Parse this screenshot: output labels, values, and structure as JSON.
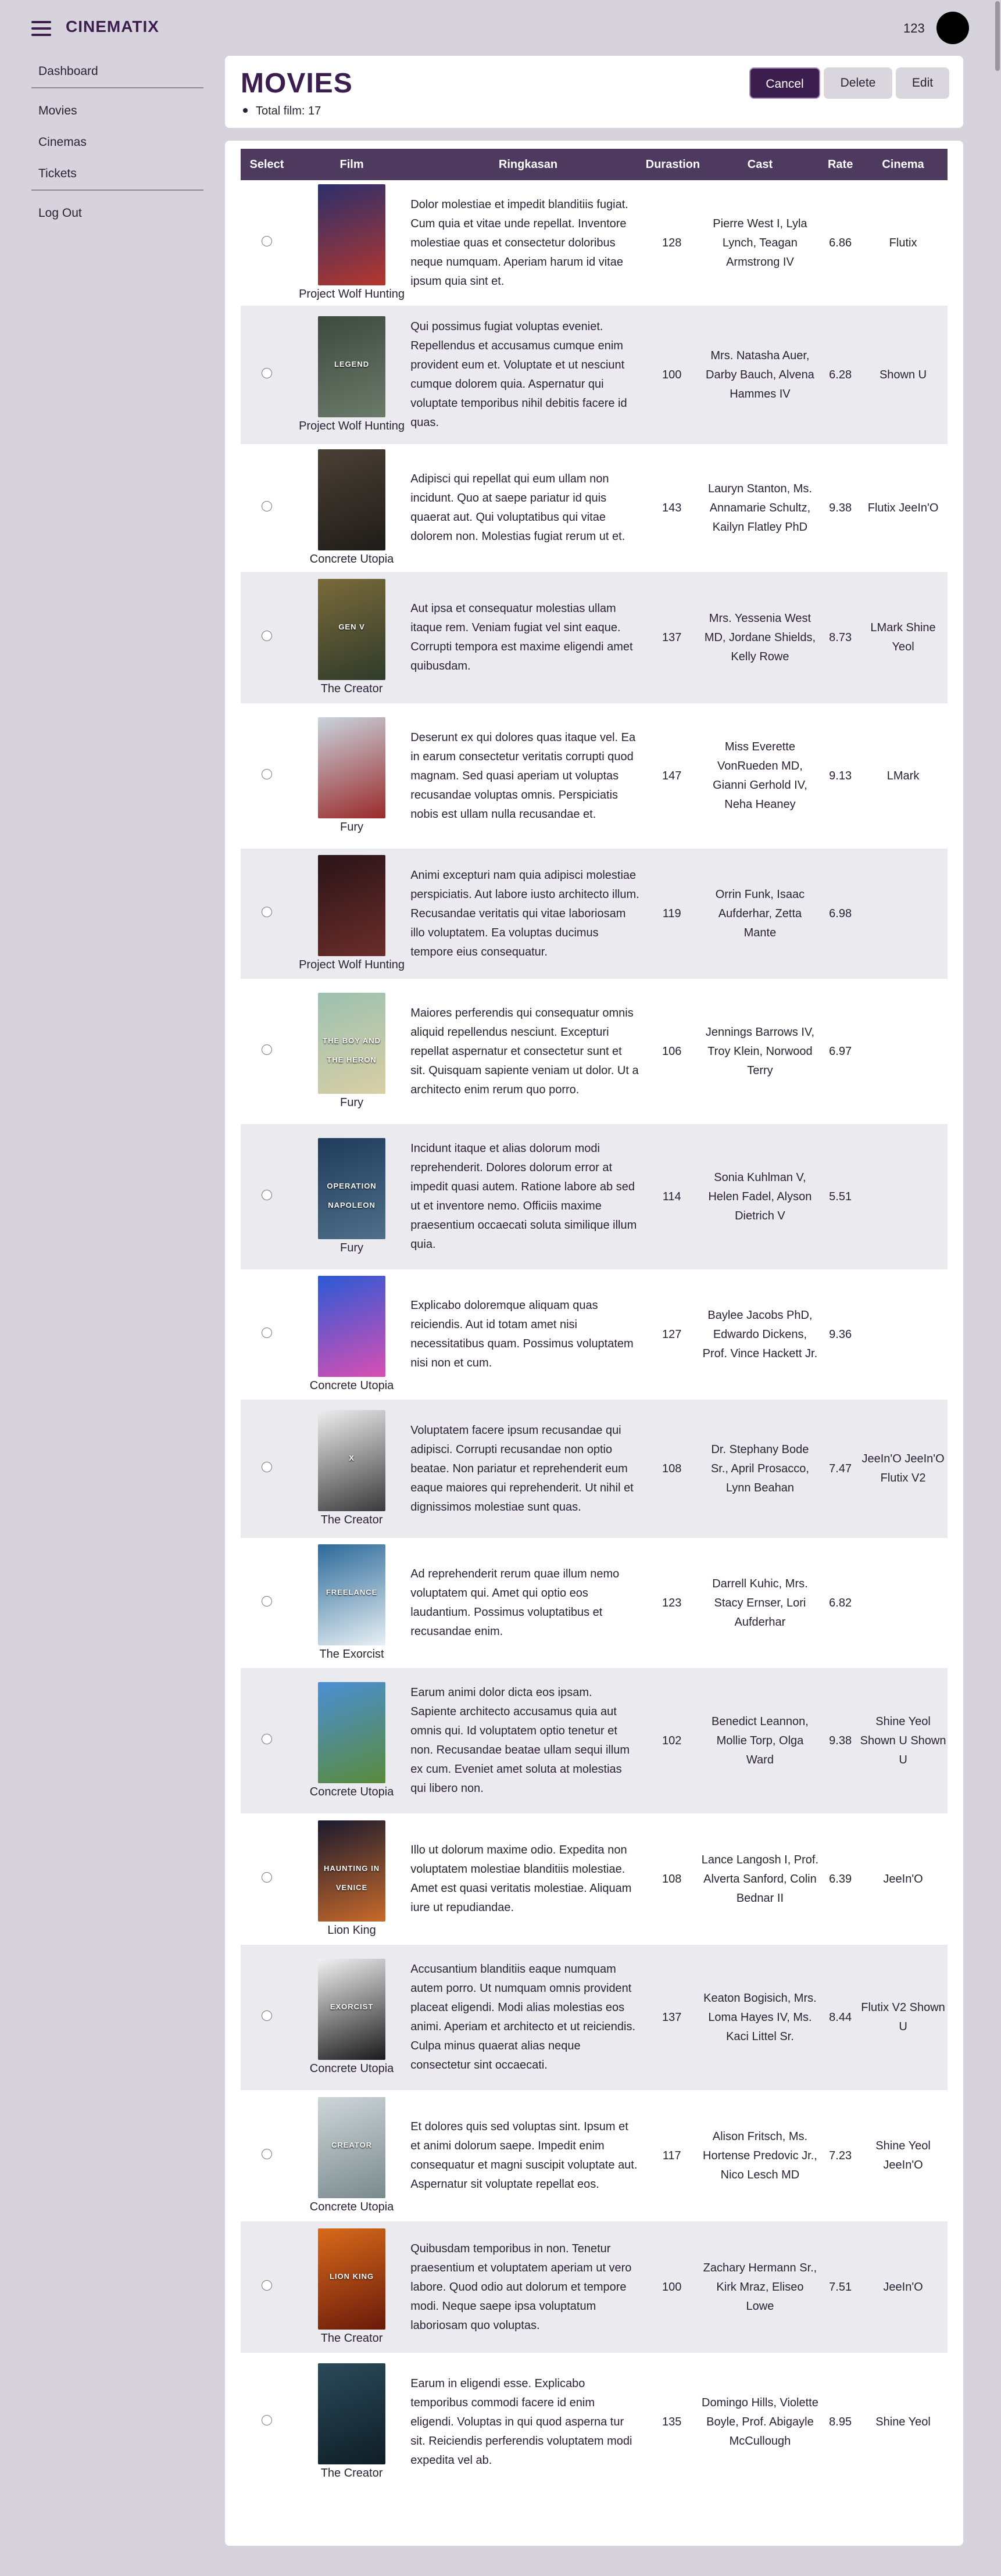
{
  "app": {
    "brand": "CINEMATIX",
    "user_number": "123"
  },
  "sidebar": {
    "items": [
      "Dashboard",
      "Movies",
      "Cinemas",
      "Tickets",
      "Log Out"
    ]
  },
  "header": {
    "title": "MOVIES",
    "total": "Total film: 17",
    "cancel_label": "Cancel",
    "delete_label": "Delete",
    "edit_label": "Edit"
  },
  "table": {
    "columns": [
      "Select",
      "Film",
      "Ringkasan",
      "Durastion",
      "Cast",
      "Rate",
      "Cinema"
    ],
    "rows": [
      {
        "film": "Project Wolf Hunting",
        "desc": "Dolor molestiae et impedit blanditiis fugiat. Cum quia et vitae unde repellat. Inventore molestiae quas et consectetur doloribus neque numquam. Aperiam harum id vitae ipsum quia sint et.",
        "duration": "128",
        "cast": "Pierre West I, Lyla Lynch, Teagan Armstrong IV",
        "rate": "6.86",
        "cinema": "Flutix",
        "poster_colors": [
          "#2b2f6b",
          "#b4372e"
        ],
        "poster_text": ""
      },
      {
        "film": "Project Wolf Hunting",
        "desc": "Qui possimus fugiat voluptas eveniet. Repellendus et accusamus cumque enim provident eum et. Voluptate et ut nesciunt cumque dolorem quia. Aspernatur qui voluptate temporibus nihil debitis facere id quas.",
        "duration": "100",
        "cast": "Mrs. Natasha Auer, Darby Bauch, Alvena Hammes IV",
        "rate": "6.28",
        "cinema": "Shown U",
        "poster_colors": [
          "#3c4a3f",
          "#6c7a6a"
        ],
        "poster_text": "LEGEND"
      },
      {
        "film": "Concrete Utopia",
        "desc": "Adipisci qui repellat qui eum ullam non incidunt. Quo at saepe pariatur id quis quaerat aut. Qui voluptatibus qui vitae dolorem non. Molestias fugiat rerum ut et.",
        "duration": "143",
        "cast": "Lauryn Stanton, Ms. Annamarie Schultz, Kailyn Flatley PhD",
        "rate": "9.38",
        "cinema": "Flutix JeeIn'O",
        "poster_colors": [
          "#4a4035",
          "#1f1c19"
        ],
        "poster_text": ""
      },
      {
        "film": "The Creator",
        "desc": "Aut ipsa et consequatur molestias ullam itaque rem. Veniam fugiat vel sint eaque. Corrupti tempora est maxime eligendi amet quibusdam.",
        "duration": "137",
        "cast": "Mrs. Yessenia West MD, Jordane Shields, Kelly Rowe",
        "rate": "8.73",
        "cinema": "LMark Shine Yeol",
        "poster_colors": [
          "#7a6a3a",
          "#2f3b2a"
        ],
        "poster_text": "GEN V"
      },
      {
        "film": "Fury",
        "desc": "Deserunt ex qui dolores quas itaque vel. Ea in earum consectetur veritatis corrupti quod magnam. Sed quasi aperiam ut voluptas recusandae voluptas omnis. Perspiciatis nobis est ullam nulla recusandae et.",
        "duration": "147",
        "cast": "Miss Everette VonRueden MD, Gianni Gerhold IV, Neha Heaney",
        "rate": "9.13",
        "cinema": "LMark",
        "poster_colors": [
          "#c9d4de",
          "#9a2a2a"
        ],
        "poster_text": ""
      },
      {
        "film": "Project Wolf Hunting",
        "desc": "Animi excepturi nam quia adipisci molestiae perspiciatis. Aut labore iusto architecto illum. Recusandae veritatis qui vitae laboriosam illo voluptatem. Ea voluptas ducimus tempore eius consequatur.",
        "duration": "119",
        "cast": "Orrin Funk, Isaac Aufderhar, Zetta Mante",
        "rate": "6.98",
        "cinema": "",
        "poster_colors": [
          "#2a1418",
          "#6b2d2a"
        ],
        "poster_text": ""
      },
      {
        "film": "Fury",
        "desc": "Maiores perferendis qui consequatur omnis aliquid repellendus nesciunt. Excepturi repellat aspernatur et consectetur sunt et sit. Quisquam sapiente veniam ut dolor. Ut a architecto enim rerum quo porro.",
        "duration": "106",
        "cast": "Jennings Barrows IV, Troy Klein, Norwood Terry",
        "rate": "6.97",
        "cinema": "",
        "poster_colors": [
          "#9cc1b0",
          "#d9cfa5"
        ],
        "poster_text": "THE BOY AND THE HERON"
      },
      {
        "film": "Fury",
        "desc": "Incidunt itaque et alias dolorum modi reprehenderit. Dolores dolorum error at impedit quasi autem. Ratione labore ab sed ut et inventore nemo. Officiis maxime praesentium occaecati soluta similique illum quia.",
        "duration": "114",
        "cast": "Sonia Kuhlman V, Helen Fadel, Alyson Dietrich V",
        "rate": "5.51",
        "cinema": "",
        "poster_colors": [
          "#1f3b5a",
          "#4f6f8a"
        ],
        "poster_text": "OPERATION NAPOLEON"
      },
      {
        "film": "Concrete Utopia",
        "desc": "Explicabo doloremque aliquam quas reiciendis. Aut id totam amet nisi necessitatibus quam. Possimus voluptatem nisi non et cum.",
        "duration": "127",
        "cast": "Baylee Jacobs PhD, Edwardo Dickens, Prof. Vince Hackett Jr.",
        "rate": "9.36",
        "cinema": "",
        "poster_colors": [
          "#2a5ad6",
          "#d94fb3"
        ],
        "poster_text": ""
      },
      {
        "film": "The Creator",
        "desc": "Voluptatem facere ipsum recusandae qui adipisci. Corrupti recusandae non optio beatae. Non pariatur et reprehenderit eum eaque maiores qui reprehenderit. Ut nihil et dignissimos molestiae sunt quas.",
        "duration": "108",
        "cast": "Dr. Stephany Bode Sr., April Prosacco, Lynn Beahan",
        "rate": "7.47",
        "cinema": "JeeIn'O JeeIn'O Flutix V2",
        "poster_colors": [
          "#eeeeee",
          "#3a3a3a"
        ],
        "poster_text": "X"
      },
      {
        "film": "The Exorcist",
        "desc": "Ad reprehenderit rerum quae illum nemo voluptatem qui. Amet qui optio eos laudantium. Possimus voluptatibus et recusandae enim.",
        "duration": "123",
        "cast": "Darrell Kuhic, Mrs. Stacy Ernser, Lori Aufderhar",
        "rate": "6.82",
        "cinema": "",
        "poster_colors": [
          "#2b6a9a",
          "#e8f0f4"
        ],
        "poster_text": "FREELANCE"
      },
      {
        "film": "Concrete Utopia",
        "desc": "Earum animi dolor dicta eos ipsam. Sapiente architecto accusamus quia aut omnis qui. Id voluptatem optio tenetur et non. Recusandae beatae ullam sequi illum ex cum. Eveniet amet soluta at molestias qui libero non.",
        "duration": "102",
        "cast": "Benedict Leannon, Mollie Torp, Olga Ward",
        "rate": "9.38",
        "cinema": "Shine Yeol Shown U Shown U",
        "poster_colors": [
          "#4a8fd6",
          "#5a8a3a"
        ],
        "poster_text": ""
      },
      {
        "film": "Lion King",
        "desc": "Illo ut dolorum maxime odio. Expedita non voluptatem molestiae blanditiis molestiae. Amet est quasi veritatis molestiae. Aliquam iure ut repudiandae.",
        "duration": "108",
        "cast": "Lance Langosh I, Prof. Alverta Sanford, Colin Bednar II",
        "rate": "6.39",
        "cinema": "JeeIn'O",
        "poster_colors": [
          "#1a1a2e",
          "#c86a2a"
        ],
        "poster_text": "HAUNTING IN VENICE"
      },
      {
        "film": "Concrete Utopia",
        "desc": "Accusantium blanditiis eaque numquam autem porro. Ut numquam omnis provident placeat eligendi. Modi alias molestias eos animi. Aperiam et architecto et ut reiciendis. Culpa minus quaerat alias neque consectetur sint occaecati.",
        "duration": "137",
        "cast": "Keaton Bogisich, Mrs. Loma Hayes IV, Ms. Kaci Littel Sr.",
        "rate": "8.44",
        "cinema": "Flutix V2 Shown U",
        "poster_colors": [
          "#f2f2f2",
          "#1a1a1a"
        ],
        "poster_text": "EXORCIST"
      },
      {
        "film": "Concrete Utopia",
        "desc": "Et dolores quis sed voluptas sint. Ipsum et et animi dolorum saepe. Impedit enim consequatur et magni suscipit voluptate aut. Aspernatur sit voluptate repellat eos.",
        "duration": "117",
        "cast": "Alison Fritsch, Ms. Hortense Predovic Jr., Nico Lesch MD",
        "rate": "7.23",
        "cinema": "Shine Yeol JeeIn'O",
        "poster_colors": [
          "#cfd6d8",
          "#7a8a8e"
        ],
        "poster_text": "CREATOR"
      },
      {
        "film": "The Creator",
        "desc": "Quibusdam temporibus in non. Tenetur praesentium et voluptatem aperiam ut vero labore. Quod odio aut dolorum et tempore modi. Neque saepe ipsa voluptatum laboriosam quo voluptas.",
        "duration": "100",
        "cast": "Zachary Hermann Sr., Kirk Mraz, Eliseo Lowe",
        "rate": "7.51",
        "cinema": "JeeIn'O",
        "poster_colors": [
          "#d86a1a",
          "#6a1a0a"
        ],
        "poster_text": "LION KING"
      },
      {
        "film": "The Creator",
        "desc": "Earum in eligendi esse. Explicabo temporibus commodi facere id enim eligendi. Voluptas in qui quod asperna tur sit. Reiciendis perferendis voluptatem modi expedita vel ab.",
        "duration": "135",
        "cast": "Domingo Hills, Violette Boyle, Prof. Abigayle McCullough",
        "rate": "8.95",
        "cinema": "Shine Yeol",
        "poster_colors": [
          "#2a4a5a",
          "#0f1e26"
        ],
        "poster_text": ""
      }
    ]
  }
}
